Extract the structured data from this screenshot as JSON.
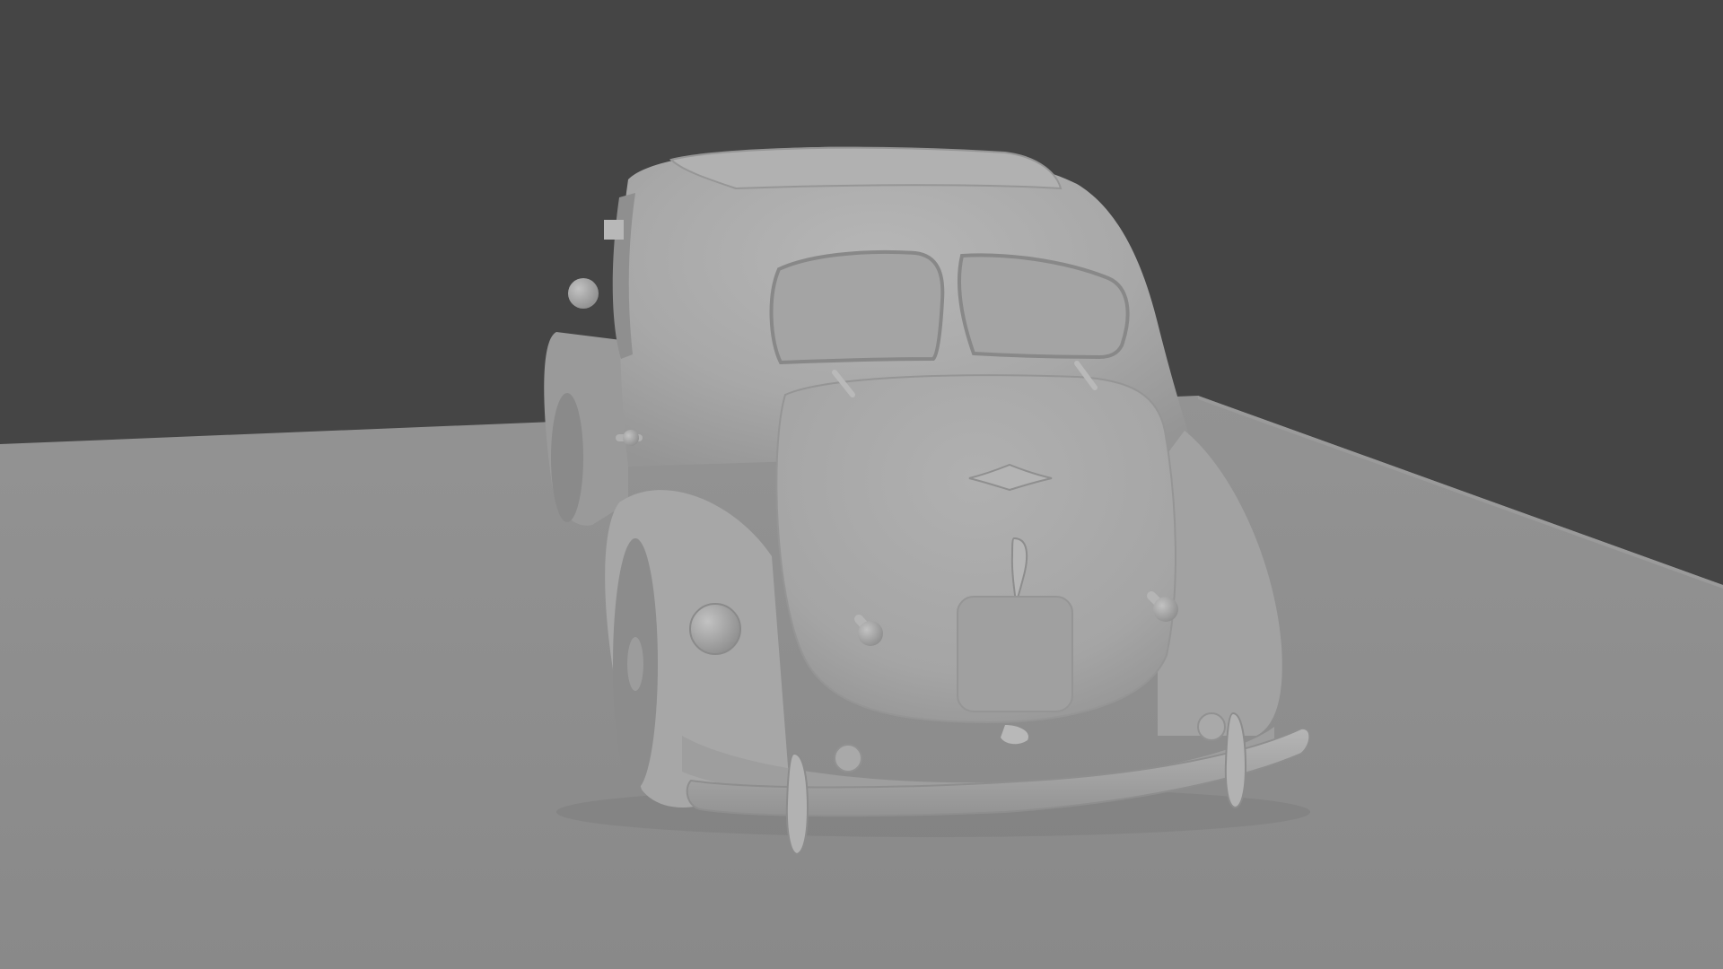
{
  "scene": {
    "subject": "vintage-sedan-rear-view",
    "render_style": "untextured-clay-gray",
    "colors": {
      "background": "#454545",
      "floor": "#8c8c8c",
      "floor_far": "#939393",
      "floor_right_face": "#8a8a8a",
      "car_body": "#a9a9a9",
      "car_highlight": "#b8b8b8",
      "car_shadow": "#8e8e8e",
      "window_panel": "#a3a3a3",
      "dark_crease": "#7a7a7a"
    }
  }
}
